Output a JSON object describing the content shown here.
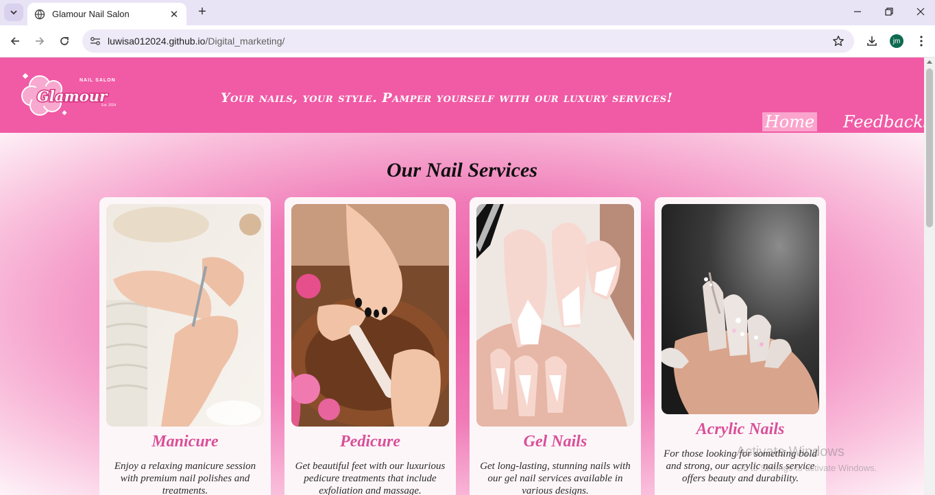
{
  "browser": {
    "tab_title": "Glamour Nail Salon",
    "url_host": "luwisa012024.github.io",
    "url_path": "/Digital_marketing/",
    "profile_initials": "jm"
  },
  "header": {
    "logo_text": "Glamour",
    "logo_subtext": "NAIL SALON",
    "logo_est": "Est. 2024",
    "tagline": "Your nails, your style. Pamper yourself with our luxury services!",
    "nav": {
      "home": "Home",
      "feedbacks": "Feedbacks"
    }
  },
  "services": {
    "title": "Our Nail Services",
    "cards": [
      {
        "name": "Manicure",
        "description": "Enjoy a relaxing manicure session with premium nail polishes and treatments."
      },
      {
        "name": "Pedicure",
        "description": "Get beautiful feet with our luxurious pedicure treatments that include exfoliation and massage."
      },
      {
        "name": "Gel Nails",
        "description": "Get long-lasting, stunning nails with our gel nail services available in various designs."
      },
      {
        "name": "Acrylic Nails",
        "description": "For those looking for something bold and strong, our acrylic nails service offers beauty and durability."
      }
    ]
  },
  "watermark": {
    "line1": "Activate Windows",
    "line2": "Go to Settings to activate Windows."
  },
  "colors": {
    "header_pink": "#f15aa5",
    "nav_active": "#fba4cd",
    "card_title": "#d94f97"
  }
}
